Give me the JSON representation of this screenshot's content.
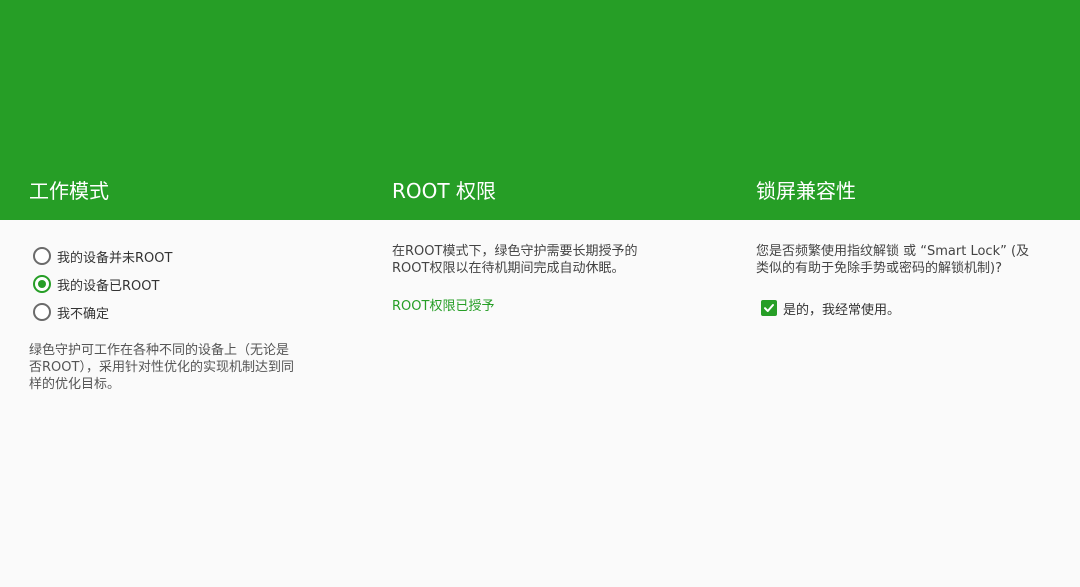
{
  "columns": [
    {
      "title": "工作模式"
    },
    {
      "title": "ROOT 权限"
    },
    {
      "title": "锁屏兼容性"
    }
  ],
  "work_mode": {
    "options": [
      {
        "label": "我的设备并未ROOT",
        "selected": false
      },
      {
        "label": "我的设备已ROOT",
        "selected": true
      },
      {
        "label": "我不确定",
        "selected": false
      }
    ],
    "description_lines": [
      "绿色守护可工作在各种不同的设备上（无论是",
      "否ROOT），采用针对性优化的实现机制达到同",
      "样的优化目标。"
    ]
  },
  "root_permission": {
    "description_lines": [
      "在ROOT模式下，绿色守护需要长期授予的",
      "ROOT权限以在待机期间完成自动休眠。"
    ],
    "status_link": "ROOT权限已授予"
  },
  "lock_screen": {
    "question_lines": [
      "您是否频繁使用指纹解锁 或 “Smart Lock” (及",
      "类似的有助于免除手势或密码的解锁机制)?"
    ],
    "checkbox_label": "是的，我经常使用。",
    "checkbox_checked": true
  },
  "colors": {
    "accent": "#269e26",
    "background": "#fafafa",
    "header_text": "#ffffff"
  }
}
